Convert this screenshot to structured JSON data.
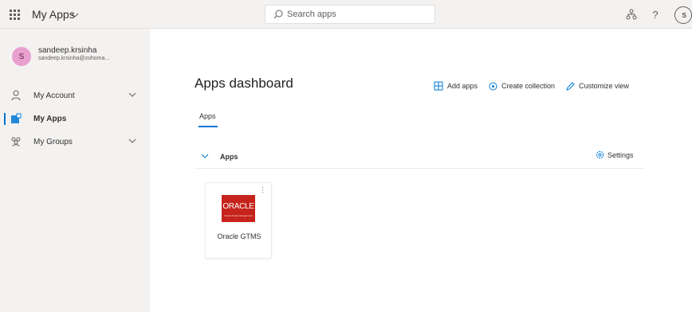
{
  "header": {
    "app_title": "My Apps",
    "search_placeholder": "Search apps",
    "help_symbol": "?",
    "user_initial": "s"
  },
  "icons": {
    "launcher": "waffle-icon",
    "search": "search-icon",
    "org": "org-chart-icon",
    "help": "help-icon"
  },
  "profile": {
    "initial": "S",
    "name": "sandeep.krsinha",
    "email": "sandeep.krsinha@zohoma..."
  },
  "sidebar": {
    "items": [
      {
        "label": "My Account",
        "icon": "person-icon",
        "expandable": true,
        "active": false
      },
      {
        "label": "My Apps",
        "icon": "apps-icon",
        "expandable": false,
        "active": true
      },
      {
        "label": "My Groups",
        "icon": "groups-icon",
        "expandable": true,
        "active": false
      }
    ]
  },
  "main": {
    "title": "Apps dashboard",
    "actions": {
      "add_apps": "Add apps",
      "create_collection": "Create collection",
      "customize_view": "Customize view"
    },
    "tabs": [
      {
        "label": "Apps",
        "active": true
      }
    ],
    "section": {
      "title": "Apps",
      "settings_label": "Settings"
    },
    "apps": [
      {
        "name": "Oracle GTMS",
        "logo_text": "ORACLE",
        "logo_subtext": "Global Trade Management"
      }
    ]
  },
  "colors": {
    "accent": "#0078d4",
    "chrome_bg": "#f3f2f1",
    "avatar_bg": "#e8a0cf",
    "oracle_red": "#c5231b"
  }
}
